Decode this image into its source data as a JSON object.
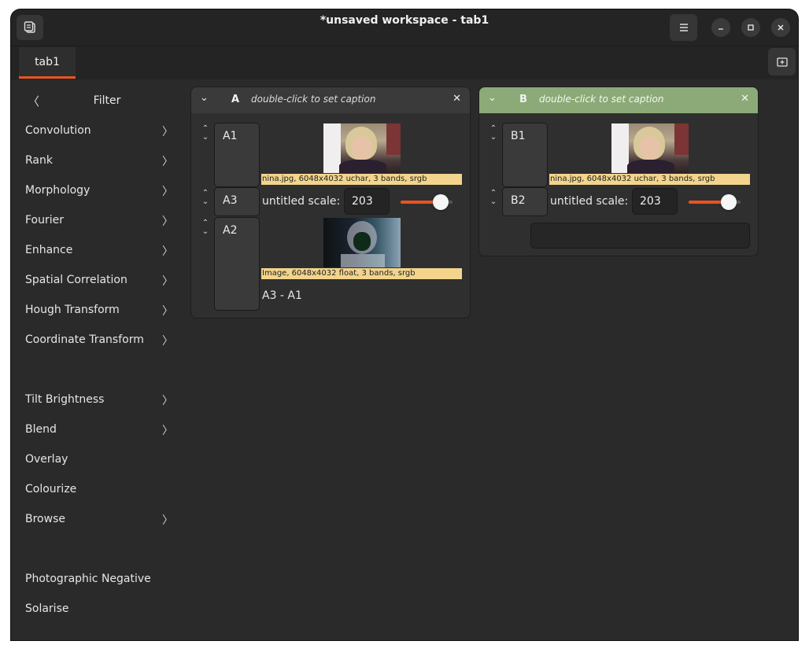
{
  "window": {
    "title": "*unsaved workspace - tab1",
    "controls": {
      "menu_icon": "hamburger-icon",
      "minimize_icon": "minimize-icon",
      "maximize_icon": "maximize-icon",
      "close_icon": "close-icon"
    },
    "left_icon": "workspace-icon"
  },
  "tabs": {
    "items": [
      {
        "label": "tab1"
      }
    ],
    "add_icon": "new-tab-icon",
    "accent": "#e95420"
  },
  "sidebar": {
    "title": "Filter",
    "back_glyph": "〈",
    "items": [
      {
        "label": "Convolution",
        "has_submenu": true
      },
      {
        "label": "Rank",
        "has_submenu": true
      },
      {
        "label": "Morphology",
        "has_submenu": true
      },
      {
        "label": "Fourier",
        "has_submenu": true
      },
      {
        "label": "Enhance",
        "has_submenu": true
      },
      {
        "label": "Spatial Correlation",
        "has_submenu": true
      },
      {
        "label": "Hough Transform",
        "has_submenu": true
      },
      {
        "label": "Coordinate Transform",
        "has_submenu": true
      },
      {
        "label": "Tilt Brightness",
        "has_submenu": true
      },
      {
        "label": "Blend",
        "has_submenu": true
      },
      {
        "label": "Overlay",
        "has_submenu": false
      },
      {
        "label": "Colourize",
        "has_submenu": false
      },
      {
        "label": "Browse",
        "has_submenu": true
      },
      {
        "label": "Photographic Negative",
        "has_submenu": false
      },
      {
        "label": "Solarise",
        "has_submenu": false
      }
    ],
    "arrow_glyph": "〉"
  },
  "columns": {
    "a": {
      "name": "A",
      "caption": "double-click to set caption",
      "rows": {
        "a1": {
          "label": "A1",
          "info": "nina.jpg, 6048x4032 uchar, 3 bands, srgb"
        },
        "a3": {
          "label": "A3",
          "scale_label": "untitled scale:",
          "scale_value": "203",
          "slider_fraction": 0.78
        },
        "a2": {
          "label": "A2",
          "info": "Image, 6048x4032 float, 3 bands, srgb",
          "expression": "A3 - A1"
        }
      }
    },
    "b": {
      "name": "B",
      "caption": "double-click to set caption",
      "header_color": "#8caa78",
      "rows": {
        "b1": {
          "label": "B1",
          "info": "nina.jpg, 6048x4032 uchar, 3 bands, srgb"
        },
        "b2": {
          "label": "B2",
          "scale_label": "untitled scale:",
          "scale_value": "203",
          "slider_fraction": 0.78
        }
      }
    }
  }
}
